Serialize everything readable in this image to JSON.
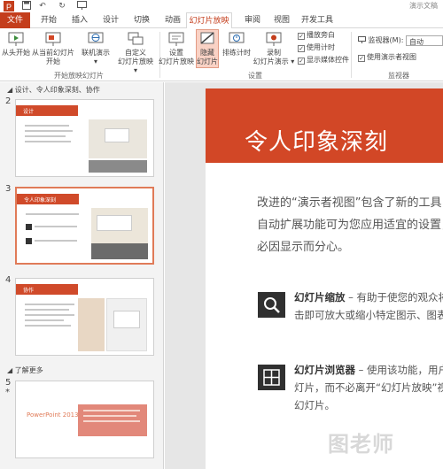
{
  "app": {
    "title": "演示文稿"
  },
  "quick_access": [
    "save-icon",
    "undo-icon",
    "redo-icon",
    "present-icon"
  ],
  "tabs": [
    "文件",
    "开始",
    "插入",
    "设计",
    "切换",
    "动画",
    "幻灯片放映",
    "审阅",
    "视图",
    "开发工具"
  ],
  "ribbon": {
    "from_start": "从头开始",
    "from_current_l1": "从当前幻灯片",
    "from_current_l2": "开始",
    "online_l1": "联机演示",
    "online_l2": "▾",
    "custom_l1": "自定义",
    "custom_l2": "幻灯片放映 ▾",
    "group_start": "开始放映幻灯片",
    "setup_l1": "设置",
    "setup_l2": "幻灯片放映",
    "hide_l1": "隐藏",
    "hide_l2": "幻灯片",
    "rehearse": "排练计时",
    "record_l1": "录制",
    "record_l2": "幻灯片演示 ▾",
    "chk_narration": "播放旁白",
    "chk_timing": "使用计时",
    "chk_media": "显示媒体控件",
    "group_setup": "设置",
    "monitor_label": "监视器(M):",
    "monitor_value": "自动",
    "presenter_view": "使用演示者视图",
    "group_monitor": "监视器"
  },
  "sidebar": {
    "section1": "设计、令人印象深刻、协作",
    "section2": "了解更多",
    "slides": [
      {
        "num": "2",
        "title": "设计"
      },
      {
        "num": "3",
        "title": "令人印象深刻"
      },
      {
        "num": "4",
        "title": "协作"
      },
      {
        "num": "5",
        "title": "PowerPoint 2013",
        "mark": "*"
      }
    ]
  },
  "slide": {
    "title": "令人印象深刻",
    "para_l1": "改进的“演示者视图”包含了新的工具，",
    "para_l2": "自动扩展功能可为您应用适宜的设置，",
    "para_l3": "必因显示而分心。",
    "feat1_title": "幻灯片缩放",
    "feat1_l1": " – 有助于使您的观众将注",
    "feat1_l2": "击即可放大或缩小特定图示、图表或",
    "feat2_title": "幻灯片浏览器",
    "feat2_l1": " – 使用该功能，用户可",
    "feat2_l2": "灯片，而不必离开“幻灯片放映”视图",
    "feat2_l3": "幻灯片。"
  },
  "watermark": "图老师",
  "colors": {
    "accent": "#d24726",
    "file_tab": "#c43e1c",
    "hidden_hl": "#f9d2c5"
  }
}
